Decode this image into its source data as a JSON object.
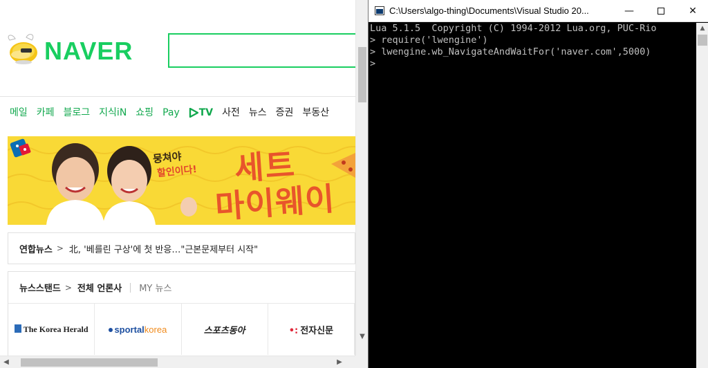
{
  "browser": {
    "logo_text": "NAVER",
    "nav_items": [
      {
        "label": "메일",
        "style": "green"
      },
      {
        "label": "카페",
        "style": "green"
      },
      {
        "label": "블로그",
        "style": "green"
      },
      {
        "label": "지식iN",
        "style": "green"
      },
      {
        "label": "쇼핑",
        "style": "green"
      },
      {
        "label": "Pay",
        "style": "green"
      },
      {
        "label": "TV",
        "style": "green"
      },
      {
        "label": "사전",
        "style": "dark"
      },
      {
        "label": "뉴스",
        "style": "dark"
      },
      {
        "label": "증권",
        "style": "dark"
      },
      {
        "label": "부동산",
        "style": "dark"
      }
    ],
    "banner": {
      "text_line1": "뭉쳐야",
      "text_line2": "할인이다!",
      "text_big1": "세트",
      "text_big2": "마이웨이"
    },
    "news_ticker": {
      "source": "연합뉴스",
      "chevron": ">",
      "headline": "北, '베를린 구상'에 첫 반응…\"근본문제부터 시작\""
    },
    "newsstand": {
      "title": "뉴스스탠드",
      "chevron": ">",
      "all_label": "전체 언론사",
      "my_label": "MY 뉴스",
      "press": [
        {
          "name": "The Korea Herald"
        },
        {
          "name_blue": "sportal",
          "name_orange": "korea"
        },
        {
          "name": "스포츠동아"
        },
        {
          "name": "전자신문"
        }
      ]
    }
  },
  "console": {
    "title": "C:\\Users\\algo-thing\\Documents\\Visual Studio 20...",
    "minimize": "—",
    "close": "✕",
    "lines": [
      "Lua 5.1.5  Copyright (C) 1994-2012 Lua.org, PUC-Rio",
      "> require('lwengine')",
      "> lwengine.wb_NavigateAndWaitFor('naver.com',5000)",
      "> "
    ]
  },
  "colors": {
    "naver_green": "#19ce60",
    "nav_green": "#12a84e",
    "banner_yellow": "#f9d936",
    "banner_orange": "#e8552b",
    "console_bg": "#000000",
    "console_text": "#c0c0c0"
  },
  "icons": {
    "logo": "naver-mascot-icon",
    "tv": "play-triangle-icon",
    "scroll_up": "arrow-up-icon",
    "scroll_down": "arrow-down-icon",
    "scroll_left": "arrow-left-icon",
    "scroll_right": "arrow-right-icon",
    "console_app": "console-window-icon"
  }
}
